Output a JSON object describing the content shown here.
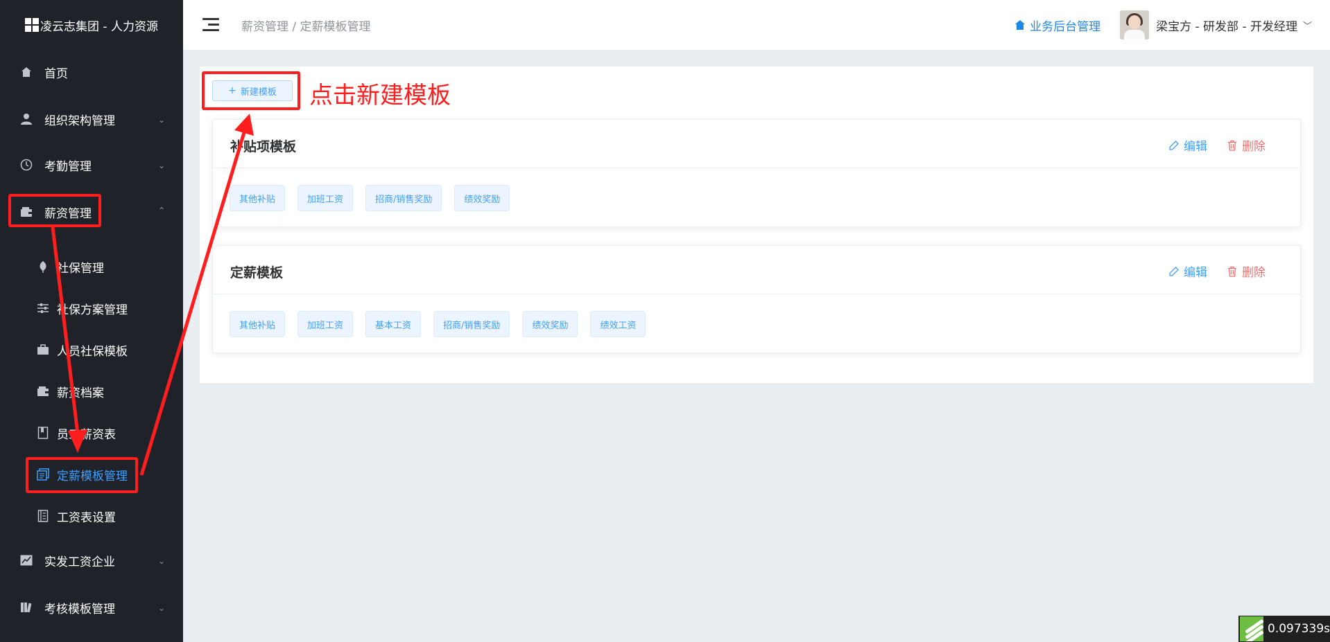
{
  "app": {
    "brand_title": "凌云志集团 - 人力资源"
  },
  "sidebar": {
    "items": [
      {
        "label": "首页",
        "icon": "home-icon"
      },
      {
        "label": "组织架构管理",
        "icon": "user-icon"
      },
      {
        "label": "考勤管理",
        "icon": "clock-icon"
      },
      {
        "label": "薪资管理",
        "icon": "wallet-icon"
      },
      {
        "label": "实发工资企业",
        "icon": "chart-icon"
      },
      {
        "label": "考核模板管理",
        "icon": "book-icon"
      }
    ],
    "subitems": [
      {
        "label": "社保管理",
        "icon": "leaf-icon"
      },
      {
        "label": "社保方案管理",
        "icon": "sliders-icon"
      },
      {
        "label": "人员社保模板",
        "icon": "briefcase-icon"
      },
      {
        "label": "薪资档案",
        "icon": "wallet-icon"
      },
      {
        "label": "员工薪资表",
        "icon": "notebook-icon"
      },
      {
        "label": "定薪模板管理",
        "icon": "document-icon"
      },
      {
        "label": "工资表设置",
        "icon": "ledger-icon"
      }
    ]
  },
  "header": {
    "breadcrumb": "薪资管理 / 定薪模板管理",
    "biz_link": "业务后台管理",
    "user": "梁宝方 - 研发部 - 开发经理"
  },
  "main": {
    "new_button": "新建模板",
    "hint": "点击新建模板",
    "edit_label": "编辑",
    "delete_label": "删除",
    "templates": [
      {
        "title": "补贴项模板",
        "tags": [
          "其他补贴",
          "加班工资",
          "招商/销售奖励",
          "绩效奖励"
        ]
      },
      {
        "title": "定薪模板",
        "tags": [
          "其他补贴",
          "加班工资",
          "基本工资",
          "招商/销售奖励",
          "绩效奖励",
          "绩效工资"
        ]
      }
    ]
  },
  "badge": {
    "value": "0.097339s"
  },
  "colors": {
    "sidebar_bg": "#1f2329",
    "accent": "#409eff",
    "danger": "#f56c6c",
    "annotation": "#ff1e1e"
  }
}
